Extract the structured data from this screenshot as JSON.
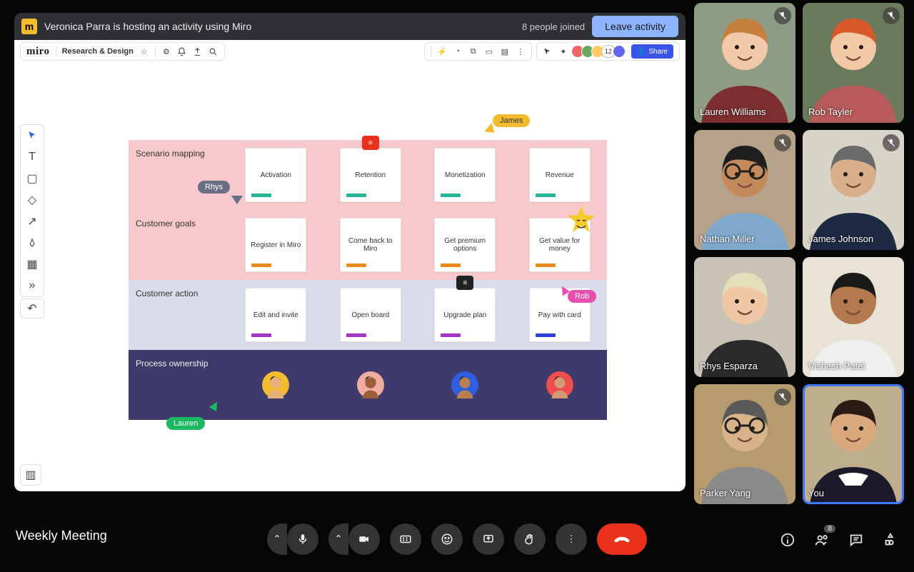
{
  "banner": {
    "host_text": "Veronica Parra is hosting an activity using Miro",
    "joined_text": "8 people joined",
    "leave_label": "Leave activity"
  },
  "miro": {
    "word": "miro",
    "board_name": "Research & Design",
    "share_label": "Share",
    "present_count": "12"
  },
  "cursors": {
    "rhys": "Rhys",
    "james": "James",
    "rob": "Rob",
    "lauren": "Lauren"
  },
  "matrix": {
    "rows": [
      {
        "label": "Scenario mapping",
        "stripe": "s-teal",
        "cards": [
          "Activation",
          "Retention",
          "Monetization",
          "Revenue"
        ]
      },
      {
        "label": "Customer goals",
        "stripe": "s-orange",
        "cards": [
          "Register in Miro",
          "Come back to Miro",
          "Get premium options",
          "Get value for money"
        ]
      },
      {
        "label": "Customer action",
        "stripe": "s-purple",
        "cards": [
          "Edit and invite",
          "Open board",
          "Upgrade plan",
          "Pay with card"
        ]
      },
      {
        "label": "Process ownership",
        "stripe": "",
        "cards": [
          "",
          "",
          "",
          ""
        ]
      }
    ]
  },
  "owners": [
    {
      "bg": "#f2bc2e",
      "skin": "#e8b07a",
      "hair": "#1a1a1a"
    },
    {
      "bg": "#efada0",
      "skin": "#9b5d3a",
      "hair": "#2a1a12"
    },
    {
      "bg": "#2f5fe0",
      "skin": "#b8804f",
      "hair": "#1a1a1a"
    },
    {
      "bg": "#ef4e4e",
      "skin": "#d49a74",
      "hair": "#3a221a"
    }
  ],
  "participants": [
    {
      "name": "Lauren Williams",
      "muted": true,
      "hair": "#c77f3f",
      "skin": "#f0c9a8",
      "shirt": "#7d2f2f",
      "bg": "#8e9c86"
    },
    {
      "name": "Rob Tayler",
      "muted": true,
      "hair": "#d9592b",
      "skin": "#f1c9a6",
      "shirt": "#b85a5a",
      "bg": "#6b7a5c"
    },
    {
      "name": "Nathan Miller",
      "muted": true,
      "hair": "#1e1e1e",
      "skin": "#c48a5c",
      "shirt": "#7fa8cc",
      "bg": "#b6a289",
      "glasses": true
    },
    {
      "name": "James Johnson",
      "muted": true,
      "hair": "#6a6a6a",
      "skin": "#d9ae8a",
      "shirt": "#1e2a44",
      "bg": "#d9d4c8"
    },
    {
      "name": "Rhys Esparza",
      "muted": false,
      "hair": "#e5deba",
      "skin": "#efc7a5",
      "shirt": "#2a2a2a",
      "bg": "#c9c3b5"
    },
    {
      "name": "Vishesh Patel",
      "muted": false,
      "hair": "#1a1a1a",
      "skin": "#b37a4f",
      "shirt": "#efefef",
      "bg": "#e9e3d6"
    },
    {
      "name": "Parker Yang",
      "muted": true,
      "hair": "#5a5a5a",
      "skin": "#d8b38a",
      "shirt": "#8a8a8a",
      "bg": "#b59b6e",
      "glasses": true
    },
    {
      "name": "You",
      "muted": false,
      "hair": "#2a1a14",
      "skin": "#d9a87d",
      "shirt": "#1a1a2a",
      "bg": "#bfae8e",
      "self": true,
      "collar": true
    }
  ],
  "meeting": {
    "title": "Weekly Meeting",
    "people_badge": "8"
  }
}
